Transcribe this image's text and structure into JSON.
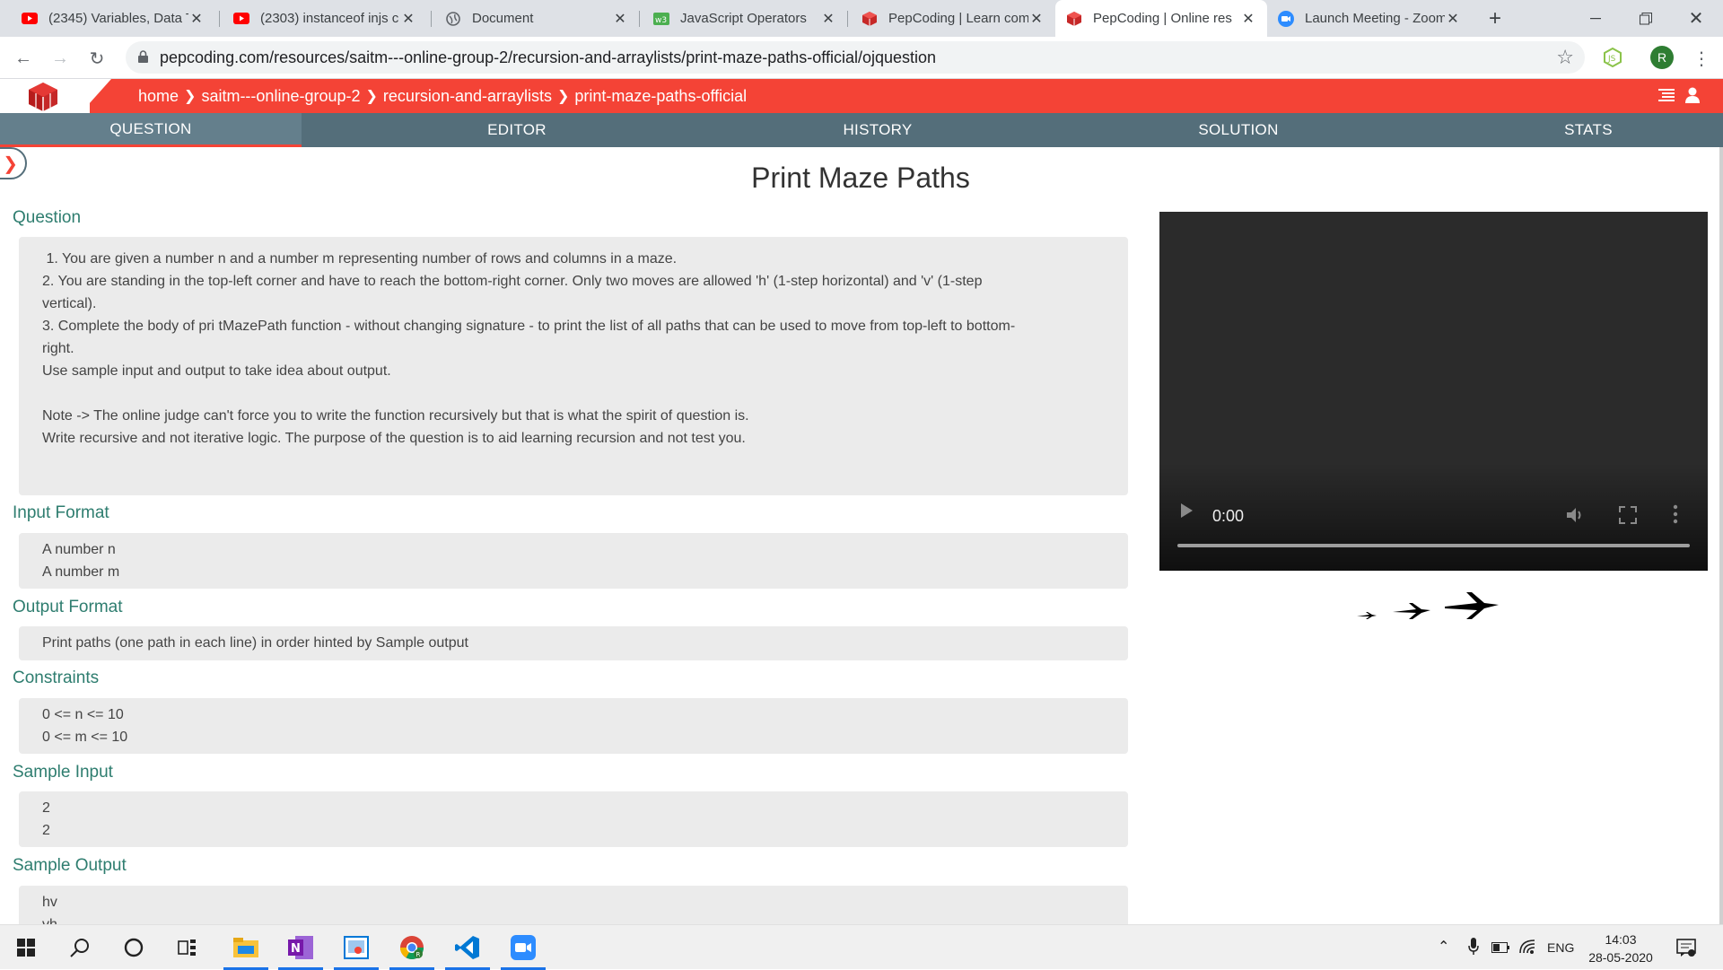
{
  "browser": {
    "tabs": [
      {
        "title": "(2345) Variables, Data T",
        "icon": "youtube-icon",
        "active": false
      },
      {
        "title": "(2303) instanceof injs c",
        "icon": "youtube-icon",
        "active": false
      },
      {
        "title": "Document",
        "icon": "globe-icon",
        "active": false
      },
      {
        "title": "JavaScript Operators",
        "icon": "w3schools-icon",
        "active": false
      },
      {
        "title": "PepCoding | Learn com",
        "icon": "pepcoding-icon",
        "active": false
      },
      {
        "title": "PepCoding | Online res",
        "icon": "pepcoding-icon",
        "active": true
      },
      {
        "title": "Launch Meeting - Zoom",
        "icon": "zoom-icon",
        "active": false
      }
    ],
    "new_tab_label": "+",
    "url": "pepcoding.com/resources/saitm---online-group-2/recursion-and-arraylists/print-maze-paths-official/ojquestion",
    "profile_initial": "R"
  },
  "site": {
    "breadcrumb": [
      "home",
      "saitm---online-group-2",
      "recursion-and-arraylists",
      "print-maze-paths-official"
    ],
    "tabs": [
      "QUESTION",
      "EDITOR",
      "HISTORY",
      "SOLUTION",
      "STATS"
    ],
    "active_tab": "QUESTION",
    "accent_color": "#f44336",
    "tab_bar_color": "#546e7a"
  },
  "problem": {
    "title": "Print Maze Paths",
    "question_label": "Question",
    "question_text": " 1. You are given a number n and a number m representing number of rows and columns in a maze.\n2. You are standing in the top-left corner and have to reach the bottom-right corner. Only two moves are allowed 'h' (1-step horizontal) and 'v' (1-step\nvertical).\n3. Complete the body of pri tMazePath function - without changing signature - to print the list of all paths that can be used to move from top-left to bottom-\nright.\nUse sample input and output to take idea about output.\n\nNote -> The online judge can't force you to write the function recursively but that is what the spirit of question is.\nWrite recursive and not iterative logic. The purpose of the question is to aid learning recursion and not test you.",
    "input_label": "Input Format",
    "input_text": "A number n\nA number m",
    "output_label": "Output Format",
    "output_text": "Print paths (one path in each line) in order hinted by Sample output",
    "constraints_label": "Constraints",
    "constraints_text": "0 <= n <= 10\n0 <= m <= 10",
    "sample_input_label": "Sample Input",
    "sample_input_text": "2\n2",
    "sample_output_label": "Sample Output",
    "sample_output_text": "hv\nvh"
  },
  "video": {
    "time": "0:00",
    "progress": 0
  },
  "taskbar": {
    "language": "ENG",
    "time": "14:03",
    "date": "28-05-2020"
  }
}
